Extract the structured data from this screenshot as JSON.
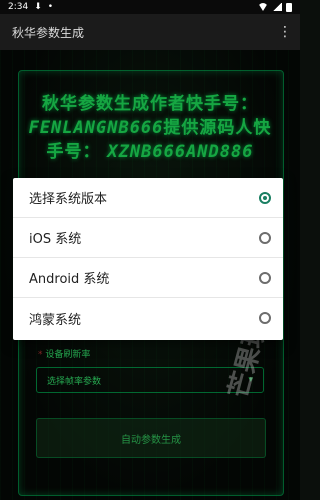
{
  "status_bar": {
    "time": "2:34"
  },
  "app_bar": {
    "title": "秋华参数生成",
    "more": "⋮"
  },
  "background": {
    "headline_1": "秋华参数生成作者快手号：",
    "headline_2": "FENLANGNB666",
    "headline_3": "提供源码人快手号：",
    "headline_4": "XZNB666AND886",
    "field_label": "设备刷新率",
    "select_placeholder": "选择帧率参数",
    "generate_button": "自动参数生成",
    "watermark": "芒果玩"
  },
  "dialog": {
    "options": [
      {
        "label": "选择系统版本",
        "checked": true
      },
      {
        "label": "iOS 系统",
        "checked": false
      },
      {
        "label": "Android 系统",
        "checked": false
      },
      {
        "label": "鸿蒙系统",
        "checked": false
      }
    ]
  },
  "colors": {
    "accent": "#1a7f62",
    "neon": "#22ff66"
  }
}
